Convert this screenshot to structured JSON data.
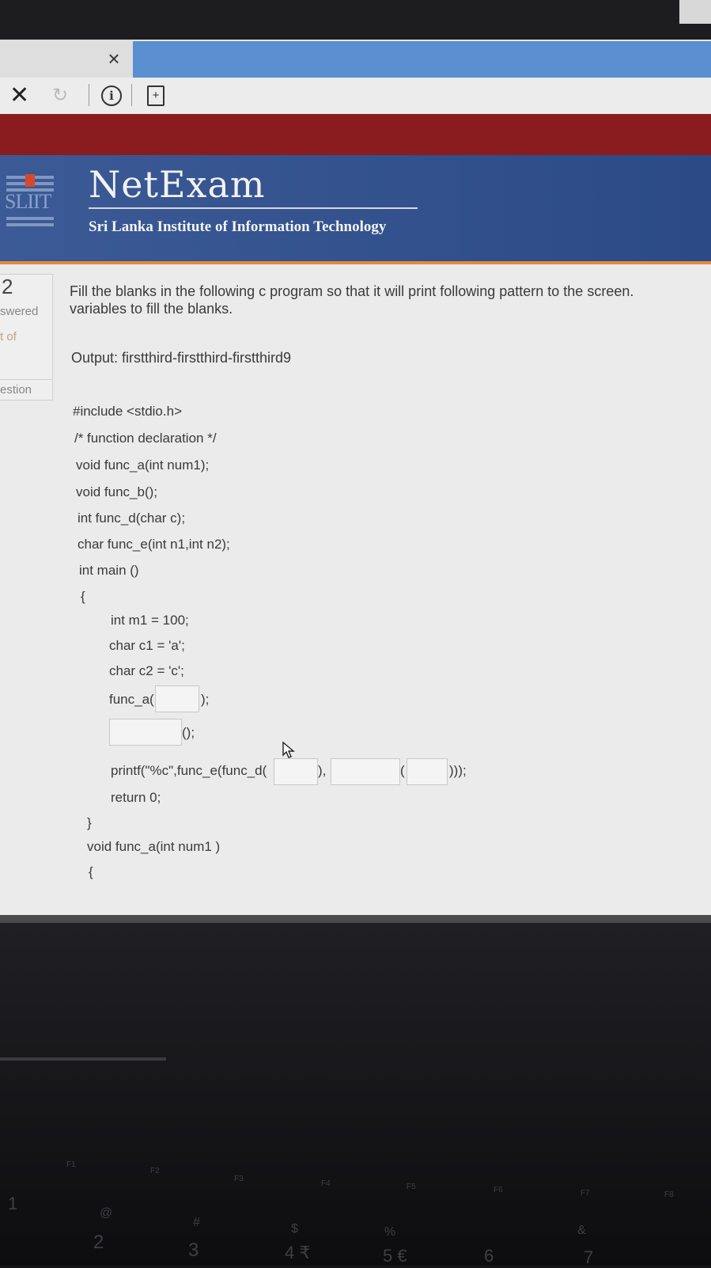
{
  "browser": {
    "tab_close": "×",
    "stop_glyph": "✕",
    "reload_glyph": "↻",
    "info_glyph": "i",
    "page_glyph": "+"
  },
  "header": {
    "logo_text": "SLIIT",
    "brand": "NetExam",
    "subtitle": "Sri Lanka Institute of Information Technology"
  },
  "sidebar": {
    "number": "2",
    "answered": "swered",
    "out_of": "t of",
    "flag": "estion"
  },
  "question": {
    "line1": "Fill the blanks in the following c program so that it will print following pattern to the screen.",
    "line2": "variables to fill the blanks.",
    "output": "Output: firstthird-firstthird-firstthird9"
  },
  "code": {
    "include": "#include <stdio.h>",
    "comment": "/* function declaration */",
    "decl_a": "void func_a(int num1);",
    "decl_b": "void func_b();",
    "decl_d": "int func_d(char c);",
    "decl_e": "char func_e(int n1,int n2);",
    "main": "int main ()",
    "open_brace": "{",
    "m1": "int m1 = 100;",
    "c1": "char c1 = 'a';",
    "c2": "char c2 = 'c';",
    "call_a_pre": "func_a(",
    "call_a_post": ");",
    "call_b_post": "();",
    "printf_pre": "printf(\"%c\",func_e(func_d(",
    "printf_mid1": "),",
    "printf_mid2": "(",
    "printf_post": ")));",
    "ret": "return 0;",
    "close_brace": "}",
    "def_a": "void func_a(int num1 )",
    "def_open": "{"
  },
  "blanks": {
    "b1": "",
    "b2": "",
    "b3": "",
    "b4": "",
    "b5": ""
  },
  "keyboard": {
    "f1": "F1",
    "f2": "F2",
    "f3": "F3",
    "f4": "F4",
    "f5": "F5",
    "f6": "F6",
    "f7": "F7",
    "f8": "F8",
    "at": "@",
    "hash": "#",
    "dollar": "$",
    "percent": "%",
    "amp": "&",
    "k2": "2",
    "k3": "3",
    "k4": "4 ₹",
    "k5": "5 €",
    "k6": "6",
    "k7": "7",
    "k1": "1"
  }
}
